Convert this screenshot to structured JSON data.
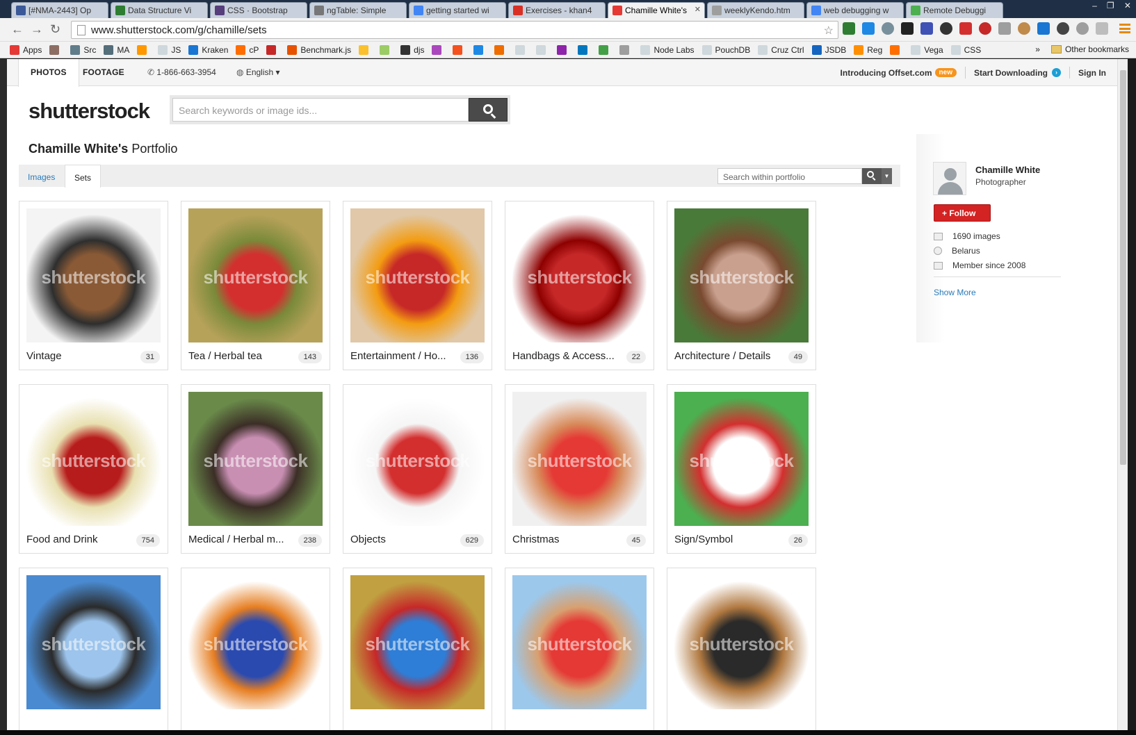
{
  "browser": {
    "tabs": [
      {
        "title": "[#NMA-2443] Op",
        "icon_color": "#3b5998",
        "active": false
      },
      {
        "title": "Data Structure Vi",
        "icon_color": "#2e7d32",
        "active": false
      },
      {
        "title": "CSS · Bootstrap",
        "icon_color": "#563d7c",
        "active": false
      },
      {
        "title": "ngTable: Simple",
        "icon_color": "#777777",
        "active": false
      },
      {
        "title": "getting started wi",
        "icon_color": "#4285f4",
        "active": false
      },
      {
        "title": "Exercises - khan4",
        "icon_color": "#d93025",
        "active": false
      },
      {
        "title": "Chamille White's",
        "icon_color": "#e53935",
        "active": true
      },
      {
        "title": "weeklyKendo.htm",
        "icon_color": "#9e9e9e",
        "active": false
      },
      {
        "title": "web debugging w",
        "icon_color": "#4285f4",
        "active": false
      },
      {
        "title": "Remote Debuggi",
        "icon_color": "#4caf50",
        "active": false
      }
    ],
    "url": "www.shutterstock.com/g/chamille/sets",
    "window_controls": [
      "–",
      "❐",
      "✕"
    ],
    "bookmarks": [
      {
        "label": "Apps",
        "color": "#e53935"
      },
      {
        "label": "",
        "color": "#8d6e63"
      },
      {
        "label": "Src",
        "color": "#607d8b"
      },
      {
        "label": "MA",
        "color": "#546e7a"
      },
      {
        "label": "",
        "color": "#ff9800"
      },
      {
        "label": "JS",
        "color": "#cfd8dc"
      },
      {
        "label": "Kraken",
        "color": "#1976d2"
      },
      {
        "label": "cP",
        "color": "#ff6d00"
      },
      {
        "label": "",
        "color": "#c62828"
      },
      {
        "label": "Benchmark.js",
        "color": "#e65100"
      },
      {
        "label": "",
        "color": "#fbc02d"
      },
      {
        "label": "",
        "color": "#9ccc65"
      },
      {
        "label": "djs",
        "color": "#333333"
      },
      {
        "label": "",
        "color": "#ab47bc"
      },
      {
        "label": "",
        "color": "#f4511e"
      },
      {
        "label": "",
        "color": "#1e88e5"
      },
      {
        "label": "",
        "color": "#ef6c00"
      },
      {
        "label": "",
        "color": "#cfd8dc"
      },
      {
        "label": "",
        "color": "#cfd8dc"
      },
      {
        "label": "",
        "color": "#8e24aa"
      },
      {
        "label": "",
        "color": "#0277bd"
      },
      {
        "label": "",
        "color": "#43a047"
      },
      {
        "label": "",
        "color": "#9e9e9e"
      },
      {
        "label": "Node Labs",
        "color": "#cfd8dc"
      },
      {
        "label": "PouchDB",
        "color": "#cfd8dc"
      },
      {
        "label": "Cruz Ctrl",
        "color": "#cfd8dc"
      },
      {
        "label": "JSDB",
        "color": "#1565c0"
      },
      {
        "label": "Reg",
        "color": "#ff8f00"
      },
      {
        "label": "",
        "color": "#ff6f00"
      },
      {
        "label": "Vega",
        "color": "#cfd8dc"
      },
      {
        "label": "CSS",
        "color": "#cfd8dc"
      }
    ],
    "overflow": "»",
    "other_bookmarks": "Other bookmarks"
  },
  "site": {
    "nav": {
      "photos": "PHOTOS",
      "footage": "FOOTAGE",
      "phone": "1-866-663-3954",
      "language": "English ▾",
      "offset": "Introducing Offset.com",
      "new_badge": "new",
      "start_downloading": "Start Downloading",
      "sign_in": "Sign In"
    },
    "logo": "shutterstock",
    "search_placeholder": "Search keywords or image ids...",
    "portfolio_owner": "Chamille White's",
    "portfolio_word": "Portfolio",
    "tabs": {
      "images": "Images",
      "sets": "Sets"
    },
    "portfolio_search_placeholder": "Search within portfolio",
    "watermark": "shutterstock",
    "sets": [
      {
        "name": "Vintage",
        "count": "31",
        "colors": [
          "#f4f4f4",
          "#8a5a36",
          "#2e2e2e"
        ]
      },
      {
        "name": "Tea / Herbal tea",
        "count": "143",
        "colors": [
          "#b7a25a",
          "#d32f2f",
          "#7a8a3a"
        ]
      },
      {
        "name": "Entertainment / Ho...",
        "count": "136",
        "colors": [
          "#e0c8a8",
          "#c62828",
          "#f39c12"
        ]
      },
      {
        "name": "Handbags & Access...",
        "count": "22",
        "colors": [
          "#ffffff",
          "#c62828",
          "#8e0000"
        ]
      },
      {
        "name": "Architecture / Details",
        "count": "49",
        "colors": [
          "#4a7a3a",
          "#c9a08e",
          "#7a4a30"
        ]
      },
      {
        "name": "Food and Drink",
        "count": "754",
        "colors": [
          "#ffffff",
          "#b71c1c",
          "#e8e0b0"
        ]
      },
      {
        "name": "Medical / Herbal m...",
        "count": "238",
        "colors": [
          "#6a8a4a",
          "#c98fb3",
          "#3b2e26"
        ]
      },
      {
        "name": "Objects",
        "count": "629",
        "colors": [
          "#ffffff",
          "#d32f2f",
          "#f5f5f5"
        ]
      },
      {
        "name": "Christmas",
        "count": "45",
        "colors": [
          "#f0f0f0",
          "#e53935",
          "#d88a5a"
        ]
      },
      {
        "name": "Sign/Symbol",
        "count": "26",
        "colors": [
          "#4caf50",
          "#ffffff",
          "#d32f2f"
        ]
      },
      {
        "name": "",
        "count": "",
        "colors": [
          "#4a8ad0",
          "#9cc4ec",
          "#2a2a2a"
        ]
      },
      {
        "name": "",
        "count": "",
        "colors": [
          "#ffffff",
          "#2a4ab0",
          "#e67e22"
        ]
      },
      {
        "name": "",
        "count": "",
        "colors": [
          "#c0a040",
          "#2e7dd6",
          "#c62828"
        ]
      },
      {
        "name": "",
        "count": "",
        "colors": [
          "#9cc8ec",
          "#e53935",
          "#d8a070"
        ]
      },
      {
        "name": "",
        "count": "",
        "colors": [
          "#ffffff",
          "#2a2a2a",
          "#b07840"
        ]
      }
    ],
    "profile": {
      "name": "Chamille White",
      "role": "Photographer",
      "follow": "+ Follow",
      "images": "1690 images",
      "location": "Belarus",
      "member_since": "Member since 2008",
      "show_more": "Show More"
    }
  }
}
